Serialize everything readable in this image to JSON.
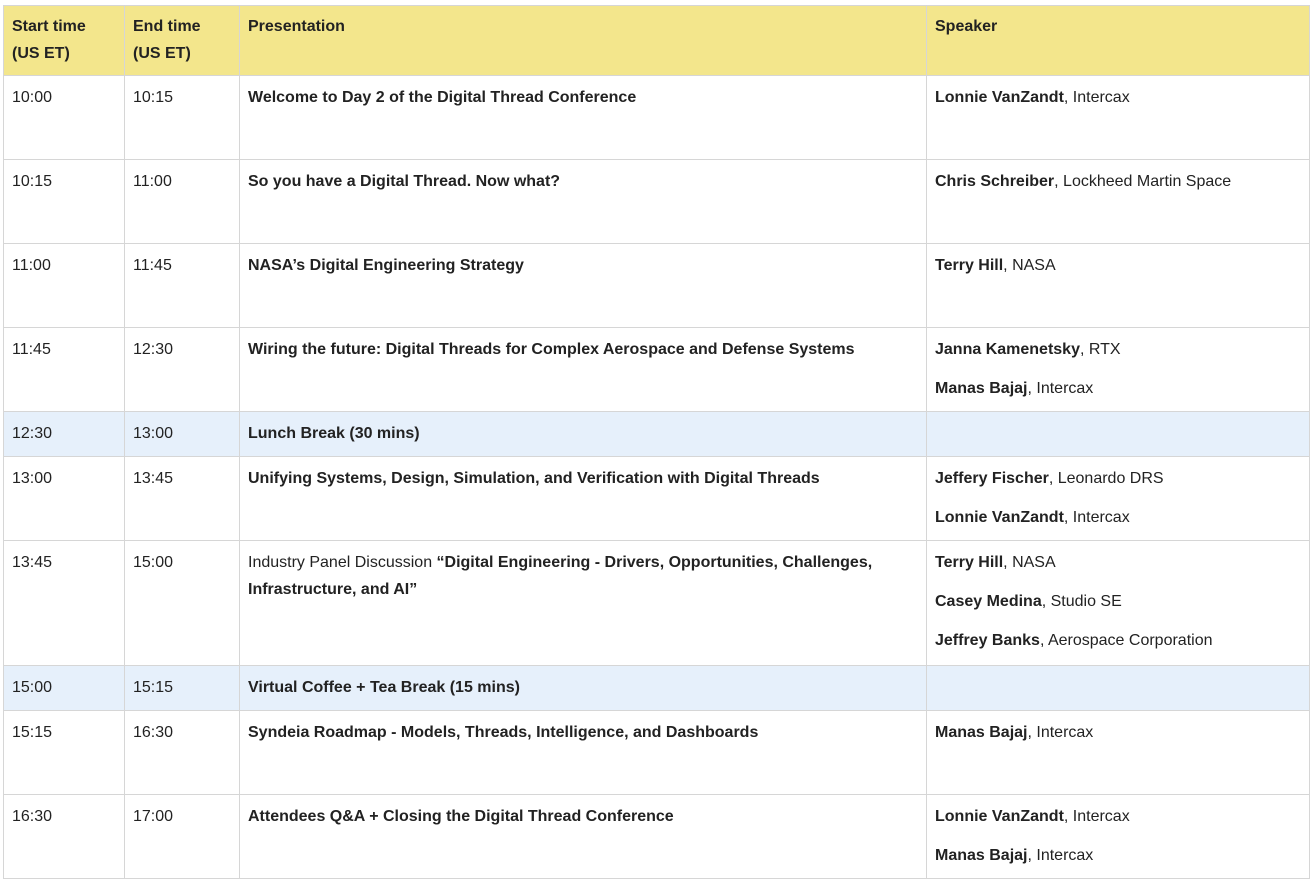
{
  "headers": [
    "Start time (US ET)",
    "End time (US ET)",
    "Presentation",
    "Speaker"
  ],
  "rows": [
    {
      "start": "10:00",
      "end": "10:15",
      "pres_prefix": "",
      "pres": "Welcome to Day 2 of the Digital Thread Conference",
      "break": false,
      "speakers": [
        {
          "name": "Lonnie VanZandt",
          "org": ", Intercax"
        }
      ]
    },
    {
      "start": "10:15",
      "end": "11:00",
      "pres_prefix": "",
      "pres": "So you have a Digital Thread.  Now what?",
      "break": false,
      "speakers": [
        {
          "name": "Chris Schreiber",
          "org": ", Lockheed Martin Space"
        }
      ]
    },
    {
      "start": "11:00",
      "end": "11:45",
      "pres_prefix": "",
      "pres": "NASA’s Digital Engineering Strategy",
      "break": false,
      "speakers": [
        {
          "name": "Terry Hill",
          "org": ", NASA"
        }
      ]
    },
    {
      "start": "11:45",
      "end": "12:30",
      "pres_prefix": "",
      "pres": "Wiring the future: Digital Threads for Complex Aerospace and Defense Systems",
      "break": false,
      "speakers": [
        {
          "name": "Janna Kamenetsky",
          "org": ", RTX"
        },
        {
          "name": "Manas Bajaj",
          "org": ", Intercax"
        }
      ]
    },
    {
      "start": "12:30",
      "end": "13:00",
      "pres_prefix": "",
      "pres": "Lunch Break (30 mins)",
      "break": true,
      "speakers": []
    },
    {
      "start": "13:00",
      "end": "13:45",
      "pres_prefix": "",
      "pres": "Unifying Systems, Design, Simulation, and Verification with Digital Threads",
      "break": false,
      "speakers": [
        {
          "name": "Jeffery Fischer",
          "org": ", Leonardo DRS"
        },
        {
          "name": "Lonnie VanZandt",
          "org": ", Intercax"
        }
      ]
    },
    {
      "start": "13:45",
      "end": "15:00",
      "pres_prefix": "Industry Panel Discussion ",
      "pres": "“Digital Engineering - Drivers, Opportunities, Challenges, Infrastructure, and AI”",
      "break": false,
      "speakers": [
        {
          "name": "Terry Hill",
          "org": ", NASA"
        },
        {
          "name": "Casey Medina",
          "org": ", Studio SE"
        },
        {
          "name": "Jeffrey Banks",
          "org": ", Aerospace Corporation"
        }
      ]
    },
    {
      "start": "15:00",
      "end": "15:15",
      "pres_prefix": "",
      "pres": "Virtual Coffee + Tea Break (15 mins)",
      "break": true,
      "speakers": []
    },
    {
      "start": "15:15",
      "end": "16:30",
      "pres_prefix": "",
      "pres": "Syndeia Roadmap - Models, Threads, Intelligence, and Dashboards",
      "break": false,
      "speakers": [
        {
          "name": "Manas Bajaj",
          "org": ", Intercax"
        }
      ]
    },
    {
      "start": "16:30",
      "end": "17:00",
      "pres_prefix": "",
      "pres": "Attendees Q&A + Closing the Digital Thread Conference",
      "break": false,
      "speakers": [
        {
          "name": "Lonnie VanZandt",
          "org": ", Intercax"
        },
        {
          "name": "Manas Bajaj",
          "org": ", Intercax"
        }
      ]
    }
  ]
}
